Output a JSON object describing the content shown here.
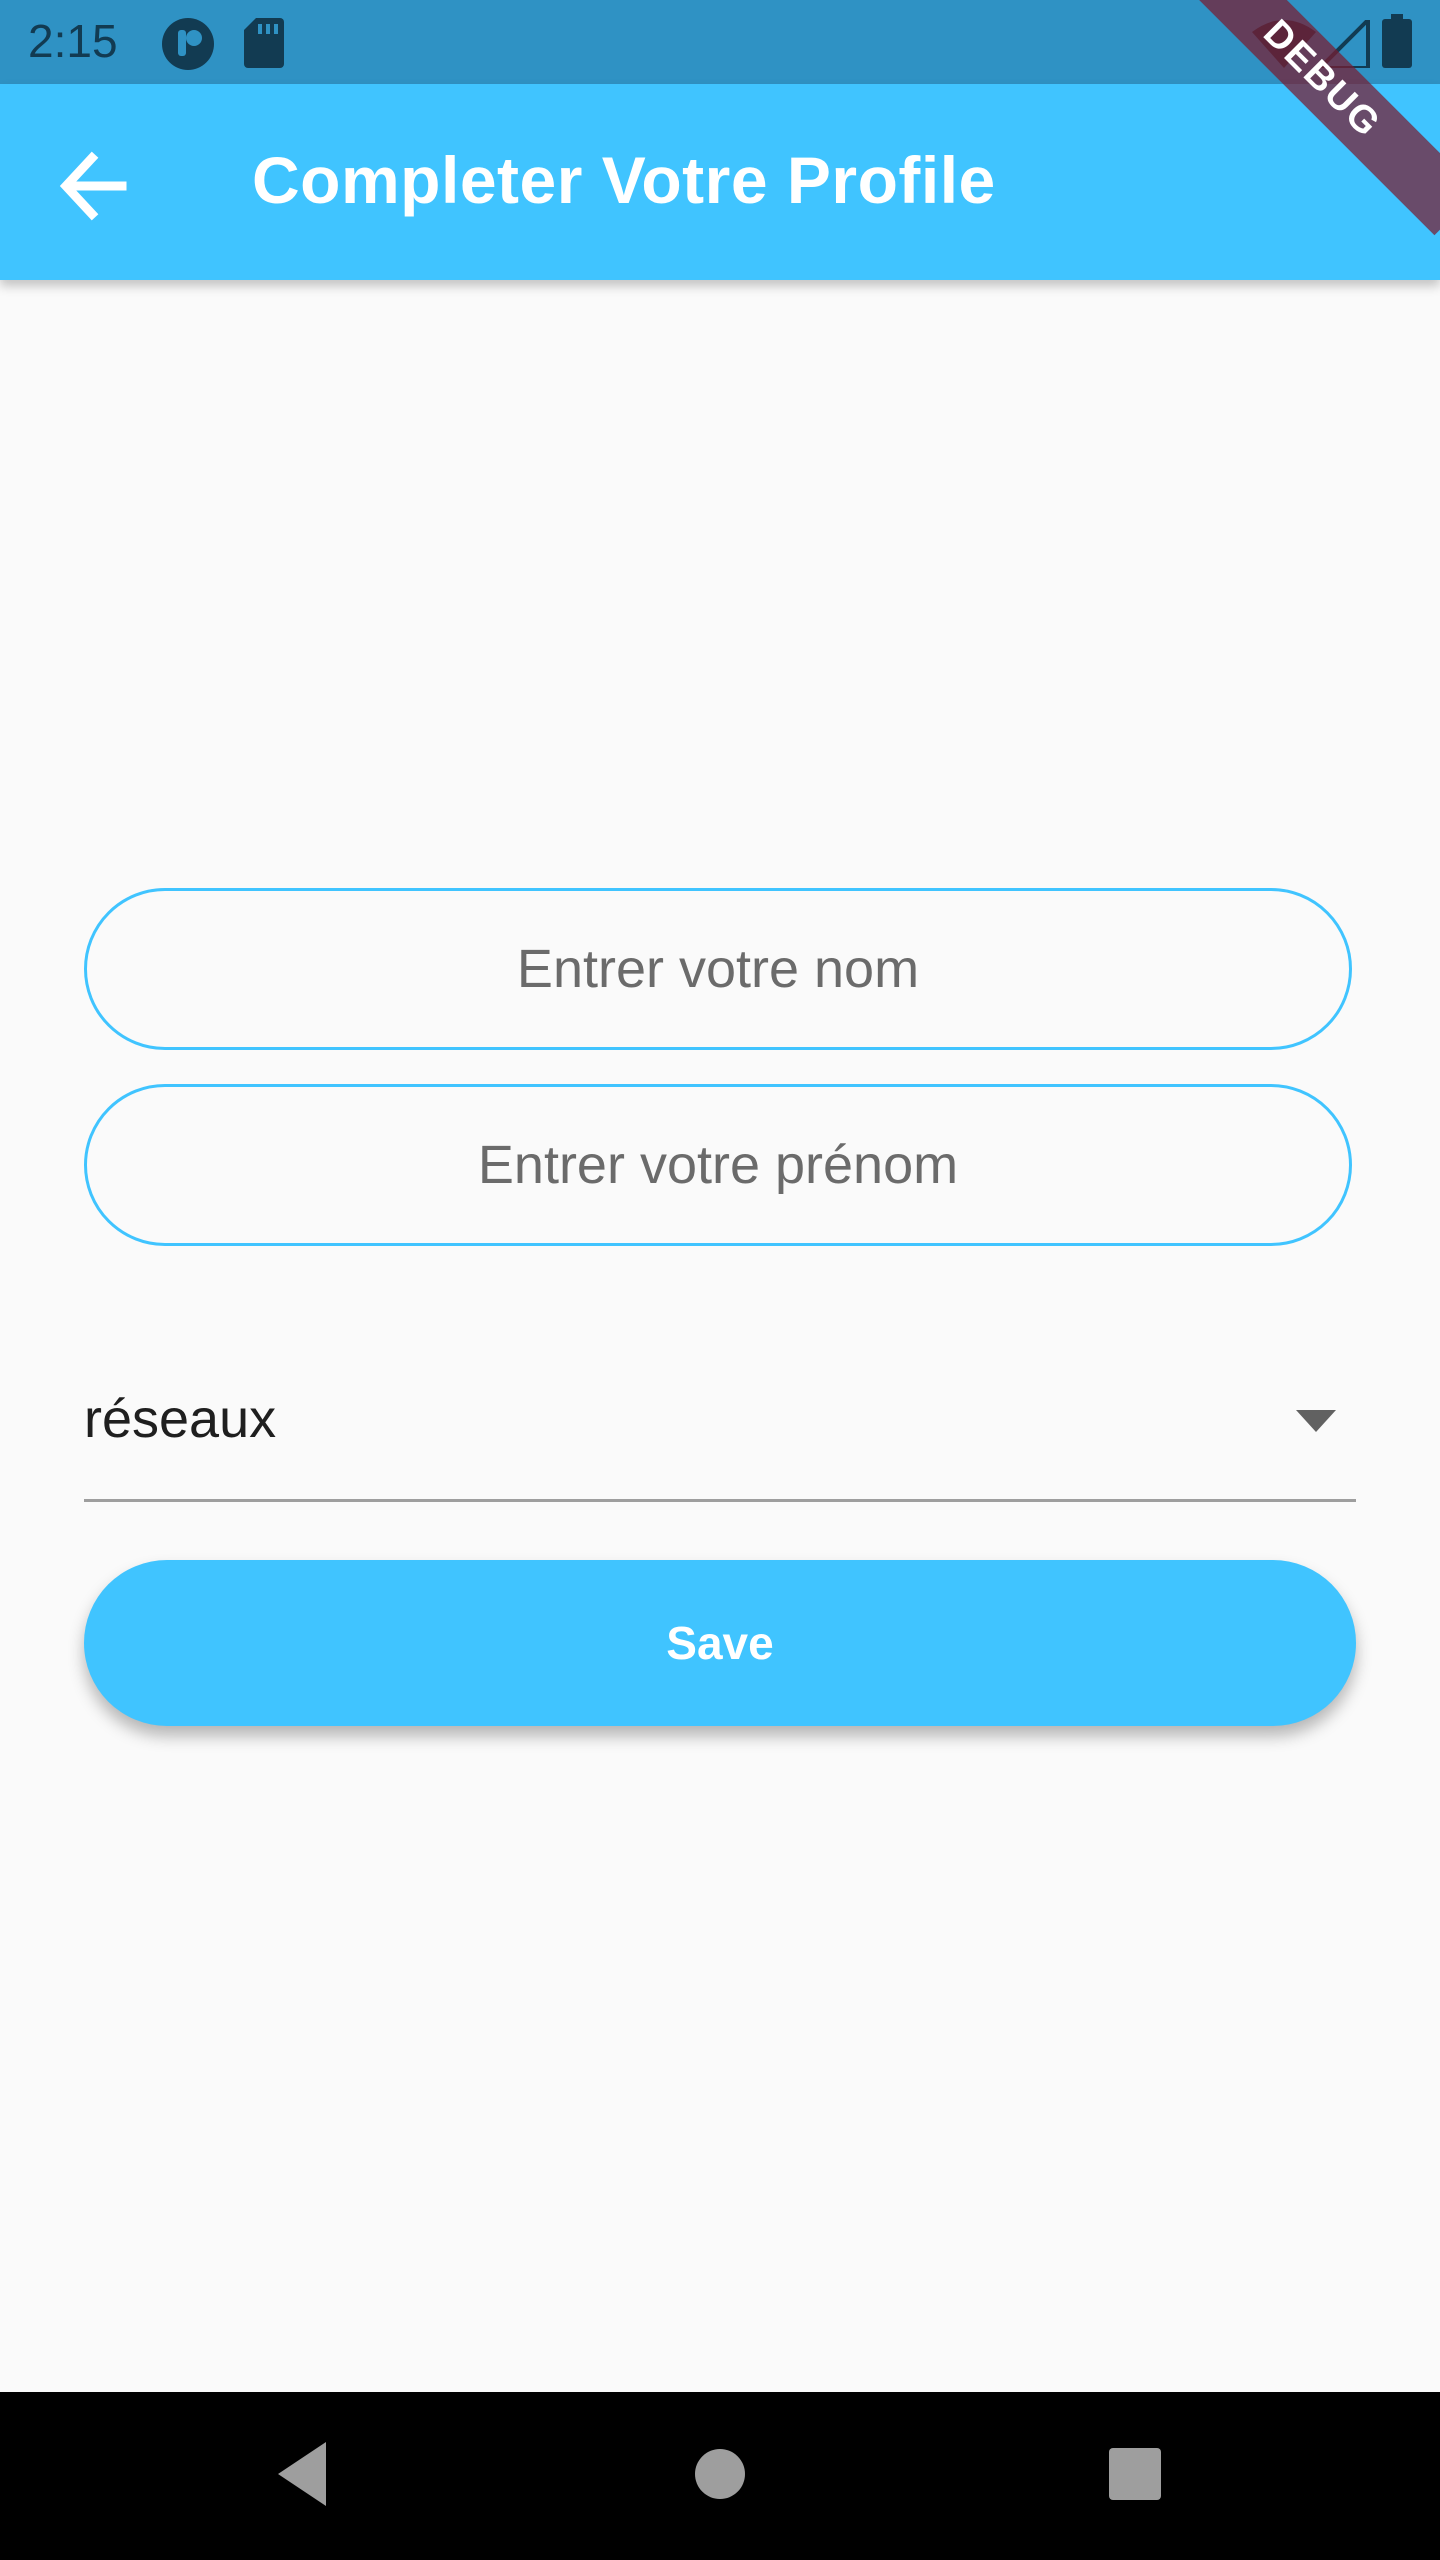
{
  "status_bar": {
    "time": "2:15",
    "icons": [
      "notification-app-icon",
      "sd-card-icon",
      "wifi-icon",
      "signal-icon",
      "battery-icon"
    ]
  },
  "app_bar": {
    "back_icon": "arrow-back-icon",
    "title": "Completer Votre Profile",
    "color": "#40c4ff"
  },
  "debug_banner": {
    "label": "DEBUG"
  },
  "form": {
    "nom_placeholder": "Entrer votre nom",
    "prenom_placeholder": "Entrer votre prénom",
    "dropdown_value": "réseaux",
    "dropdown_icon": "arrow-drop-down-icon",
    "save_label": "Save"
  },
  "nav_bar": {
    "icons": [
      "back-triangle-icon",
      "home-circle-icon",
      "recents-square-icon"
    ]
  }
}
